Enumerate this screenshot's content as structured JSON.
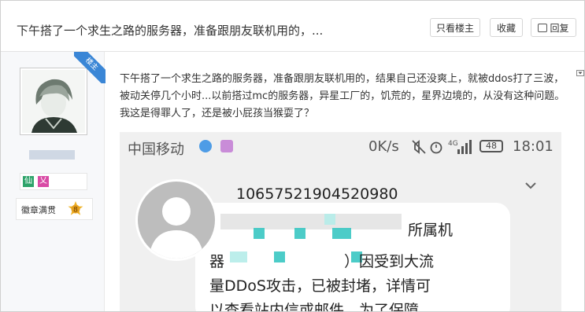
{
  "header": {
    "title": "下午搭了一个求生之路的服务器，准备跟朋友联机用的，...",
    "only_op_label": "只看楼主",
    "favorite_label": "收藏",
    "reply_label": "回复"
  },
  "author": {
    "op_ribbon": "楼主",
    "badges": [
      "仙",
      "乂"
    ],
    "medal_label": "徽章满贯",
    "medal_level": "8"
  },
  "post": {
    "text": "下午搭了一个求生之路的服务器，准备跟朋友联机用的，结果自己还没爽上，就被ddos打了三波，被动关停几个小时...以前搭过mc的服务器，异星工厂的，饥荒的，星界边境的，从没有这种问题。我这是得罪人了，还是被小屁孩当猴耍了？"
  },
  "screenshot": {
    "carrier": "中国移动",
    "speed": "0K/s",
    "network": "4G",
    "battery": "48",
    "time": "18:01",
    "sender": "10657521904520980",
    "line1": "所属机",
    "line2": "器　　　　　　　　）因受到大流",
    "line3": "量DDoS攻击，已被封堵，详情可",
    "line4": "以查看站内信或邮件。为了保障"
  },
  "colors": {
    "ribbon": "#3a86d6",
    "badge_green": "#2ea36a",
    "badge_pink": "#d94ba5",
    "medal": "#f0b429"
  }
}
